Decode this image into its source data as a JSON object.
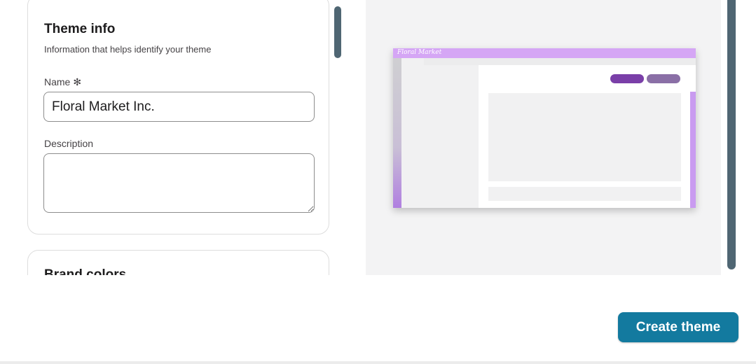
{
  "theme_info": {
    "title": "Theme info",
    "subtitle": "Information that helps identify your theme",
    "name_label": "Name",
    "required_mark": "✻",
    "name_value": "Floral Market Inc.",
    "description_label": "Description",
    "description_value": ""
  },
  "brand_colors": {
    "title": "Brand colors"
  },
  "preview": {
    "workspace_name": "Floral Market",
    "colors": {
      "topbar": "#d5a6f5",
      "primary_button": "#7a3fa8",
      "secondary_button": "#8a6fa6",
      "accent": "#c99bf0"
    }
  },
  "footer": {
    "create_label": "Create theme",
    "create_color": "#137a9f"
  }
}
